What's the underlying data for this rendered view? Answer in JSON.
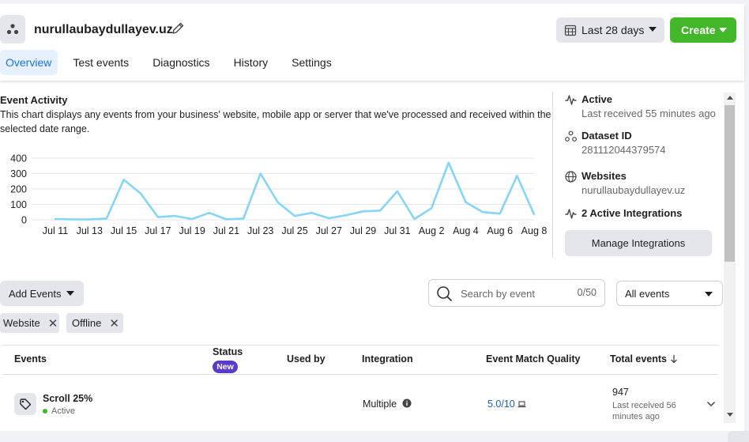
{
  "header": {
    "title": "nurullaubaydullayev.uz",
    "date_range": "Last 28 days",
    "create_label": "Create",
    "tabs": [
      {
        "label": "Overview",
        "active": true
      },
      {
        "label": "Test events",
        "active": false
      },
      {
        "label": "Diagnostics",
        "active": false
      },
      {
        "label": "History",
        "active": false
      },
      {
        "label": "Settings",
        "active": false
      }
    ]
  },
  "activity": {
    "title": "Event Activity",
    "description": "This chart displays any events from your business' website, mobile app or server that we've processed and received within the selected date range."
  },
  "chart_data": {
    "type": "line",
    "x_tick_labels": [
      "Jul 11",
      "Jul 13",
      "Jul 15",
      "Jul 17",
      "Jul 19",
      "Jul 21",
      "Jul 23",
      "Jul 25",
      "Jul 27",
      "Jul 29",
      "Jul 31",
      "Aug 2",
      "Aug 4",
      "Aug 6",
      "Aug 8"
    ],
    "y_ticks": [
      0,
      100,
      200,
      300,
      400
    ],
    "ylim": [
      0,
      400
    ],
    "x": [
      "Jul 11",
      "Jul 12",
      "Jul 13",
      "Jul 14",
      "Jul 15",
      "Jul 16",
      "Jul 17",
      "Jul 18",
      "Jul 19",
      "Jul 20",
      "Jul 21",
      "Jul 22",
      "Jul 23",
      "Jul 24",
      "Jul 25",
      "Jul 26",
      "Jul 27",
      "Jul 28",
      "Jul 29",
      "Jul 30",
      "Jul 31",
      "Aug 1",
      "Aug 2",
      "Aug 3",
      "Aug 4",
      "Aug 5",
      "Aug 6",
      "Aug 7",
      "Aug 8"
    ],
    "values": [
      5,
      3,
      2,
      8,
      260,
      170,
      18,
      25,
      5,
      45,
      3,
      8,
      300,
      115,
      25,
      45,
      10,
      30,
      55,
      60,
      185,
      5,
      75,
      370,
      115,
      50,
      40,
      285,
      35
    ],
    "color": "#86d5f7",
    "grid": true
  },
  "sidebar": {
    "status_label": "Active",
    "status_sub": "Last received 55 minutes ago",
    "dataset_label": "Dataset ID",
    "dataset_id": "281112044379574",
    "websites_label": "Websites",
    "website": "nurullaubaydullayev.uz",
    "integrations_label": "2 Active Integrations",
    "manage_label": "Manage Integrations"
  },
  "toolbar": {
    "add_events_label": "Add Events",
    "search_placeholder": "Search by event",
    "search_count": "0/50",
    "filter_value": "All events",
    "chips": [
      "Website",
      "Offline"
    ]
  },
  "table": {
    "columns": {
      "events": "Events",
      "status": "Status",
      "status_badge": "New",
      "used_by": "Used by",
      "integration": "Integration",
      "quality": "Event Match Quality",
      "total": "Total events"
    },
    "rows": [
      {
        "name": "Scroll 25%",
        "status": "Active",
        "integration": "Multiple",
        "quality": "5.0/10",
        "total": "947",
        "total_sub": "Last received 56 minutes ago"
      }
    ]
  }
}
